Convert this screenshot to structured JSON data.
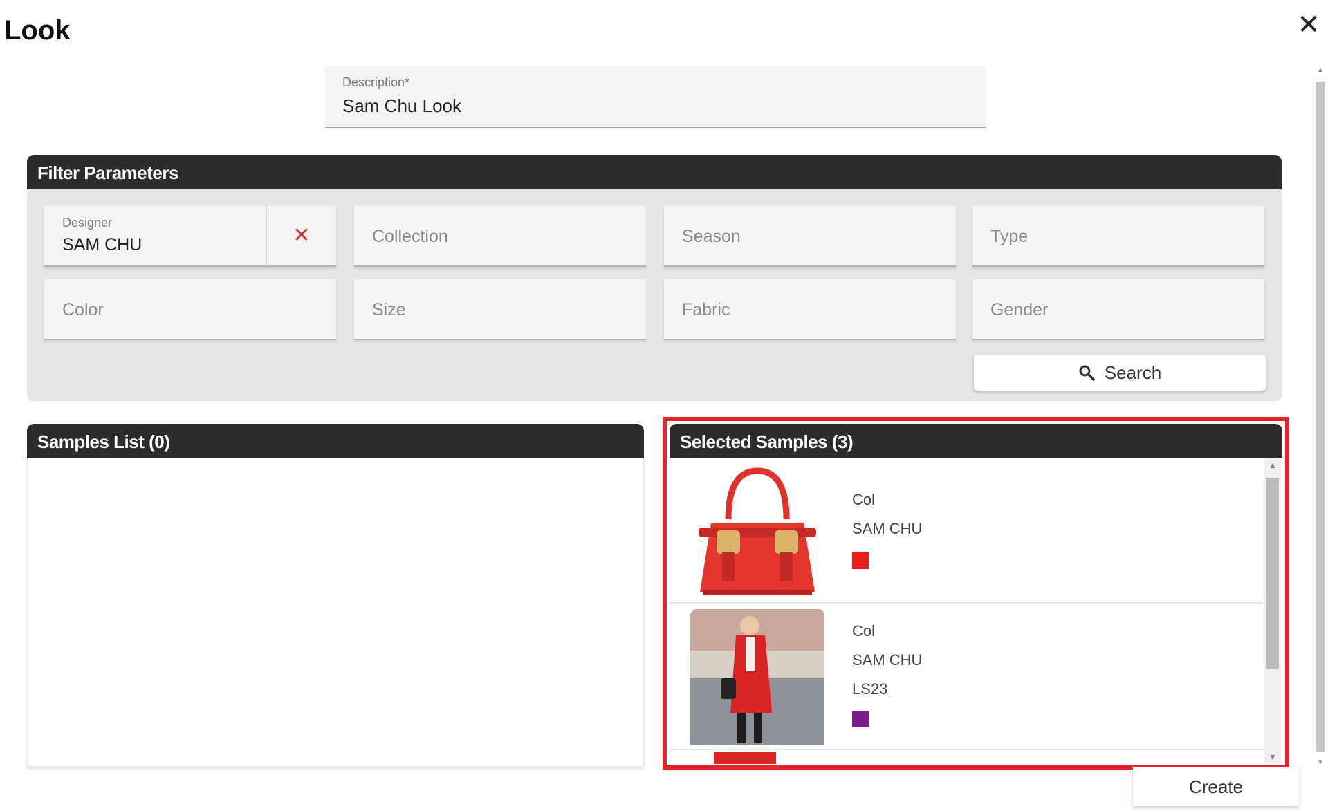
{
  "window": {
    "title": "Look",
    "close_icon": "close-icon"
  },
  "description": {
    "label": "Description*",
    "value": "Sam Chu Look"
  },
  "filter": {
    "header": "Filter Parameters",
    "designer": {
      "label": "Designer",
      "value": "SAM CHU"
    },
    "collection": "Collection",
    "season": "Season",
    "type": "Type",
    "color": "Color",
    "size": "Size",
    "fabric": "Fabric",
    "gender": "Gender",
    "search_label": "Search"
  },
  "samples_list": {
    "header": "Samples List (0)"
  },
  "selected_samples": {
    "header": "Selected Samples (3)",
    "items": [
      {
        "line1": "Col",
        "line2": "SAM CHU",
        "swatch": "#e8201c",
        "image": "red handbag"
      },
      {
        "line1": "Col",
        "line2": "SAM CHU",
        "line3": "LS23",
        "swatch": "#7b1c8e",
        "image": "red coat"
      }
    ]
  },
  "create_label": "Create",
  "colors": {
    "header_bg": "#2c2c2c",
    "highlight": "#e3242b",
    "clear_x": "#d03030"
  }
}
